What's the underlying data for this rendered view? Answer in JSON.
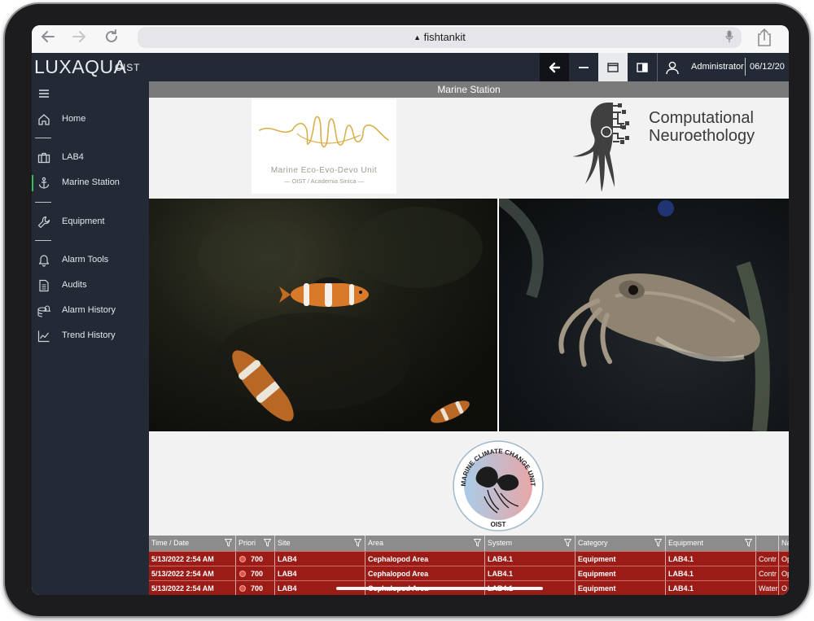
{
  "browser": {
    "url": "fishtankit"
  },
  "app": {
    "logo": "LUXAQUA",
    "org": "OIST",
    "user": "Administrator",
    "date": "06/12/20"
  },
  "sidebar": {
    "items": [
      {
        "label": "Home",
        "icon": "home-icon"
      },
      {
        "label": "LAB4",
        "icon": "briefcase-icon"
      },
      {
        "label": "Marine Station",
        "icon": "anchor-icon",
        "active": true
      },
      {
        "label": "Equipment",
        "icon": "wrench-icon"
      },
      {
        "label": "Alarm Tools",
        "icon": "bell-icon"
      },
      {
        "label": "Audits",
        "icon": "document-icon"
      },
      {
        "label": "Alarm History",
        "icon": "database-bell-icon"
      },
      {
        "label": "Trend History",
        "icon": "line-chart-icon"
      }
    ]
  },
  "page": {
    "title": "Marine Station"
  },
  "logos": {
    "unit_name": "Marine Eco-Evo-Devo Unit",
    "unit_sub": "— OIST / Academia Sinica —",
    "cn_line1": "Computational",
    "cn_line2": "Neuroethology",
    "badge_top": "MARINE CLIMATE CHANGE UNIT",
    "badge_bottom": "OIST"
  },
  "table": {
    "headers": [
      "Time / Date",
      "Priori",
      "Site",
      "Area",
      "System",
      "Category",
      "Equipment",
      "",
      "Na"
    ],
    "rows": [
      [
        "5/13/2022 2:54 AM",
        "700",
        "LAB4",
        "Cephalopod Area",
        "LAB4.1",
        "Equipment",
        "LAB4.1",
        "Contr",
        "Op"
      ],
      [
        "5/13/2022 2:54 AM",
        "700",
        "LAB4",
        "Cephalopod Area",
        "LAB4.1",
        "Equipment",
        "LAB4.1",
        "Contr",
        "Op"
      ],
      [
        "5/13/2022 2:54 AM",
        "700",
        "LAB4",
        "Cephalopod Area",
        "LAB4.1",
        "Equipment",
        "LAB4.1",
        "Water",
        "O"
      ]
    ]
  },
  "colors": {
    "header_bg": "#232a36",
    "alarm_row": "#9b1b17",
    "active_accent": "#2fbf5a"
  }
}
